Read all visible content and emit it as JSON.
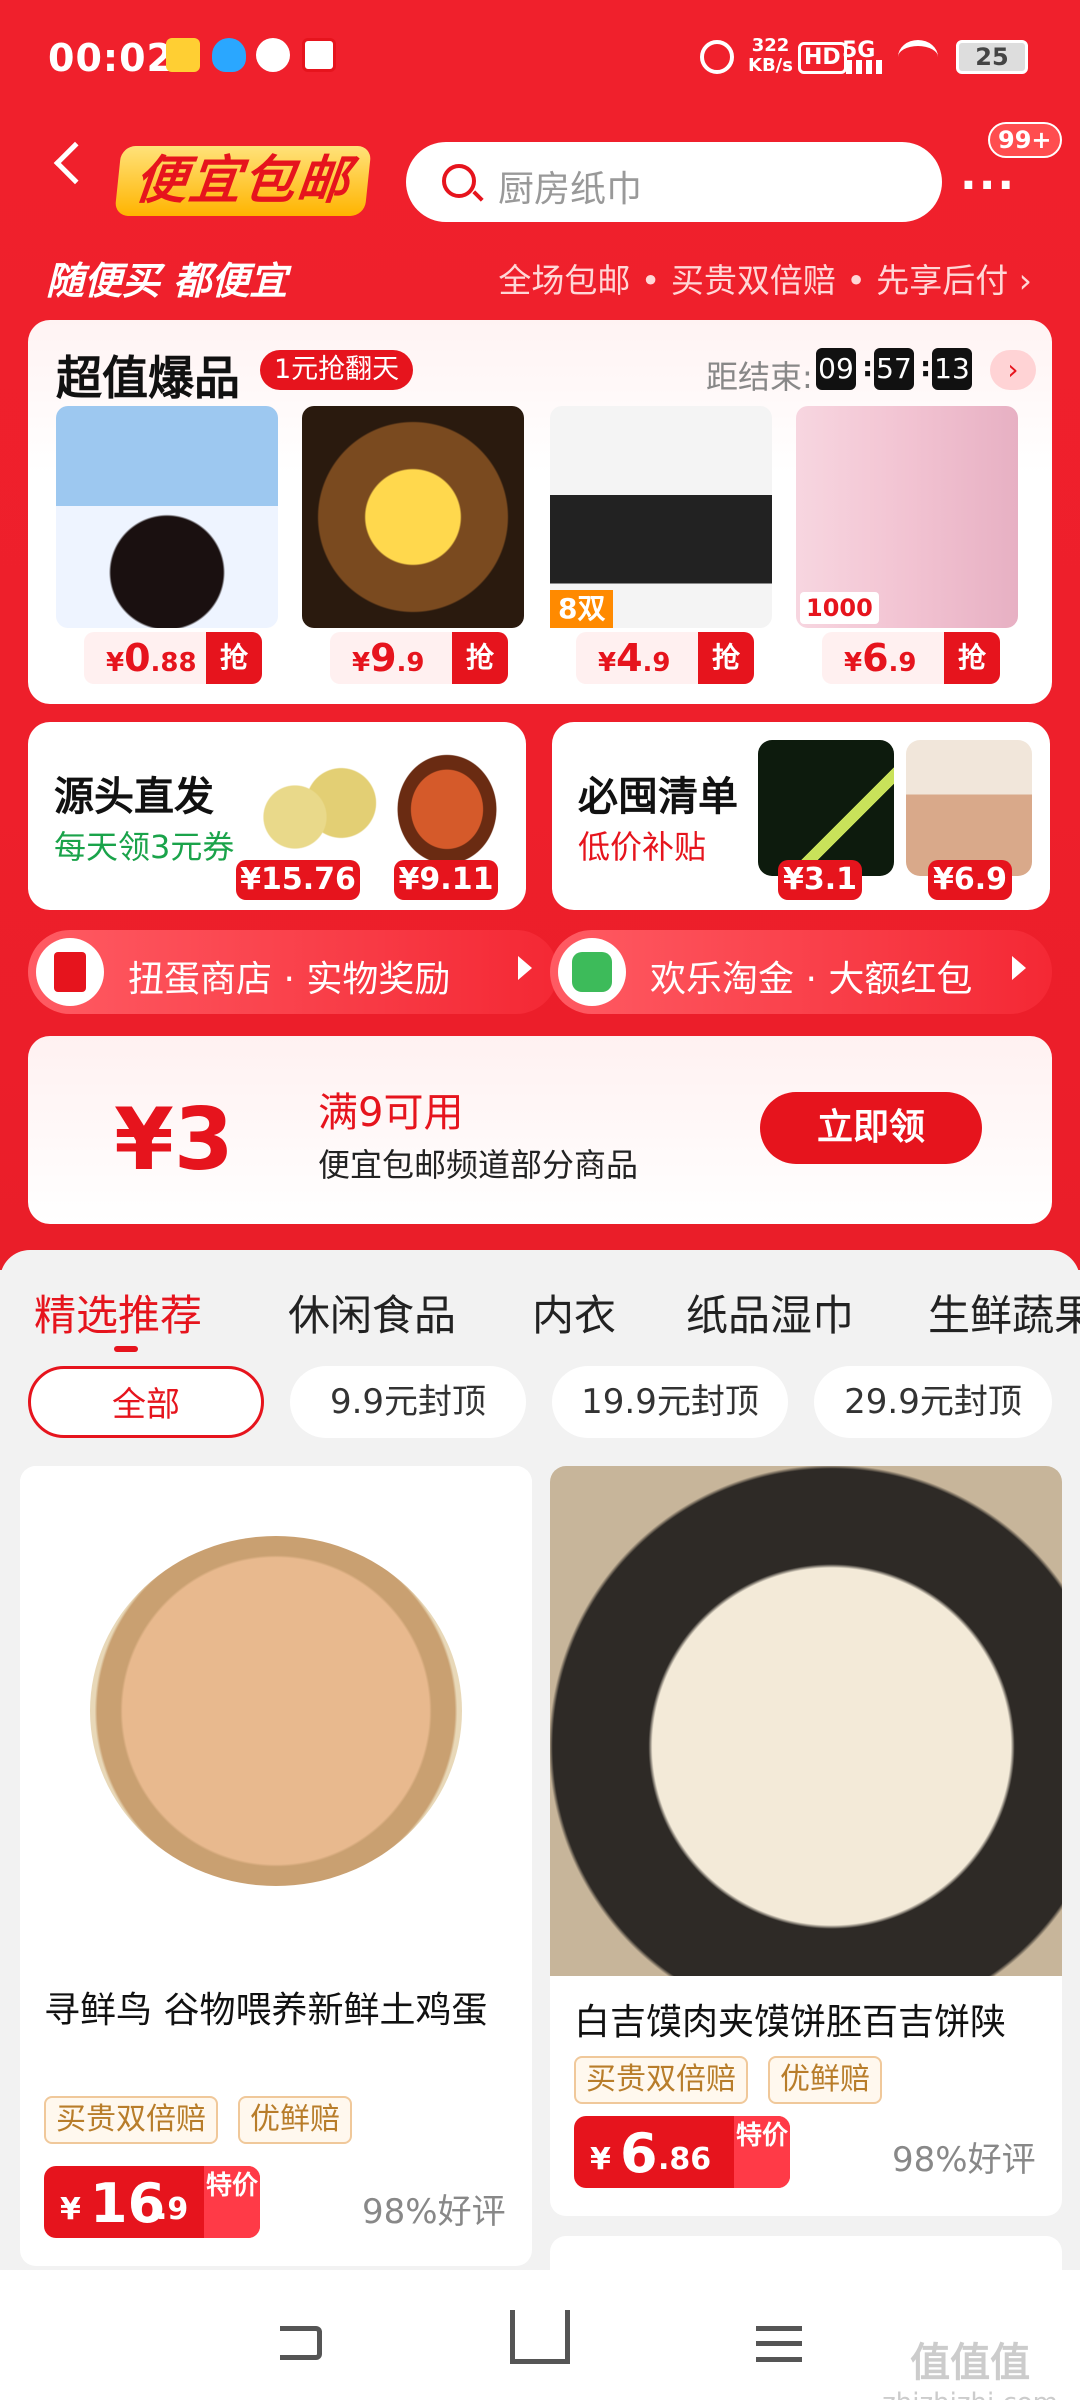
{
  "status_bar": {
    "time": "00:02",
    "speed_value": "322",
    "speed_unit": "KB/s",
    "hd": "HD",
    "net": "5G",
    "battery": "25"
  },
  "header": {
    "logo_text": "便宜包邮",
    "search_placeholder": "厨房纸巾",
    "more_badge": "99+",
    "more_icon": "···"
  },
  "slogan": {
    "left": "随便买 都便宜",
    "right": "全场包邮 • 买贵双倍赔 • 先享后付 ›"
  },
  "flash_sale": {
    "title": "超值爆品",
    "tag": "1元抢翻天",
    "countdown_label": "距结束:",
    "countdown": [
      "09",
      "57",
      "13"
    ],
    "grab_label": "抢",
    "items": [
      {
        "price_symbol": "¥",
        "price_int": "0",
        "price_dec": ".88"
      },
      {
        "price_symbol": "¥",
        "price_int": "9",
        "price_dec": ".9"
      },
      {
        "price_symbol": "¥",
        "price_int": "4",
        "price_dec": ".9"
      },
      {
        "price_symbol": "¥",
        "price_int": "6",
        "price_dec": ".9"
      }
    ],
    "socks_badge": "8双",
    "tissue_badge": "1000"
  },
  "source_card": {
    "title": "源头直发",
    "subtitle": "每天领3元券",
    "prices": [
      "¥15.76",
      "¥9.11"
    ]
  },
  "clear_card": {
    "title": "必囤清单",
    "subtitle": "低价补贴",
    "prices": [
      "¥3.1",
      "¥6.9"
    ]
  },
  "pills": [
    {
      "label": "扭蛋商店 · 实物奖励"
    },
    {
      "label": "欢乐淘金 · 大额红包"
    }
  ],
  "coupon": {
    "amount": "¥3",
    "condition": "满9可用",
    "scope": "便宜包邮频道部分商品",
    "button": "立即领"
  },
  "category_tabs": [
    "精选推荐",
    "休闲食品",
    "内衣",
    "纸品湿巾",
    "生鲜蔬果"
  ],
  "filters": [
    "全部",
    "9.9元封顶",
    "19.9元封顶",
    "29.9元封顶"
  ],
  "products": [
    {
      "name": "寻鲜鸟 谷物喂养新鲜土鸡蛋",
      "tags": [
        "买贵双倍赔",
        "优鲜赔"
      ],
      "price_symbol": "¥",
      "price_int": "16",
      "price_dec": ".9",
      "special": "特价",
      "praise": "98%好评"
    },
    {
      "name": "白吉馍肉夹馍饼胚百吉饼陕",
      "tags": [
        "买贵双倍赔",
        "优鲜赔"
      ],
      "price_symbol": "¥",
      "price_int": "6",
      "price_dec": ".86",
      "special": "特价",
      "praise": "98%好评"
    }
  ],
  "watermark": {
    "logo": "值值值",
    "url": "zhizhizhi.com"
  },
  "colors": {
    "brand_red": "#e6141d",
    "gold": "#ffb400"
  }
}
